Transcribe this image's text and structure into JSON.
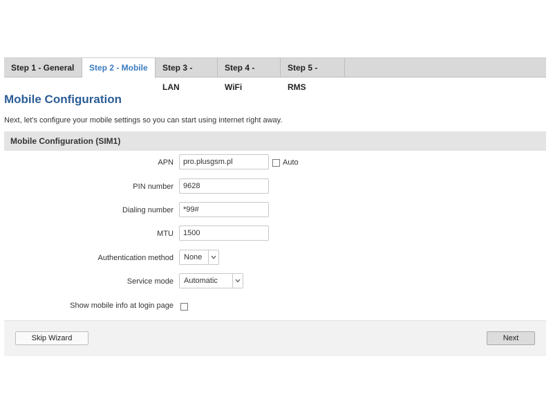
{
  "tabs": [
    {
      "label": "Step 1 - General"
    },
    {
      "label": "Step 2 - Mobile"
    },
    {
      "label": "Step 3 - LAN"
    },
    {
      "label": "Step 4 - WiFi"
    },
    {
      "label": "Step 5 - RMS"
    }
  ],
  "active_tab": "Step 2 - Mobile",
  "page": {
    "title": "Mobile Configuration",
    "description": "Next, let's configure your mobile settings so you can start using internet right away."
  },
  "section": {
    "title": "Mobile Configuration (SIM1)"
  },
  "form": {
    "apn": {
      "label": "APN",
      "value": "pro.plusgsm.pl",
      "auto_label": "Auto",
      "auto_checked": false
    },
    "pin": {
      "label": "PIN number",
      "value": "9628"
    },
    "dialing": {
      "label": "Dialing number",
      "value": "*99#"
    },
    "mtu": {
      "label": "MTU",
      "value": "1500"
    },
    "auth": {
      "label": "Authentication method",
      "value": "None"
    },
    "service": {
      "label": "Service mode",
      "value": "Automatic"
    },
    "show_info": {
      "label": "Show mobile info at login page",
      "checked": false
    }
  },
  "buttons": {
    "skip": "Skip Wizard",
    "next": "Next"
  },
  "colors": {
    "accent": "#3a7bbf",
    "title": "#2b5d96"
  },
  "icons": {
    "select_arrow": "chevron-down-icon"
  }
}
